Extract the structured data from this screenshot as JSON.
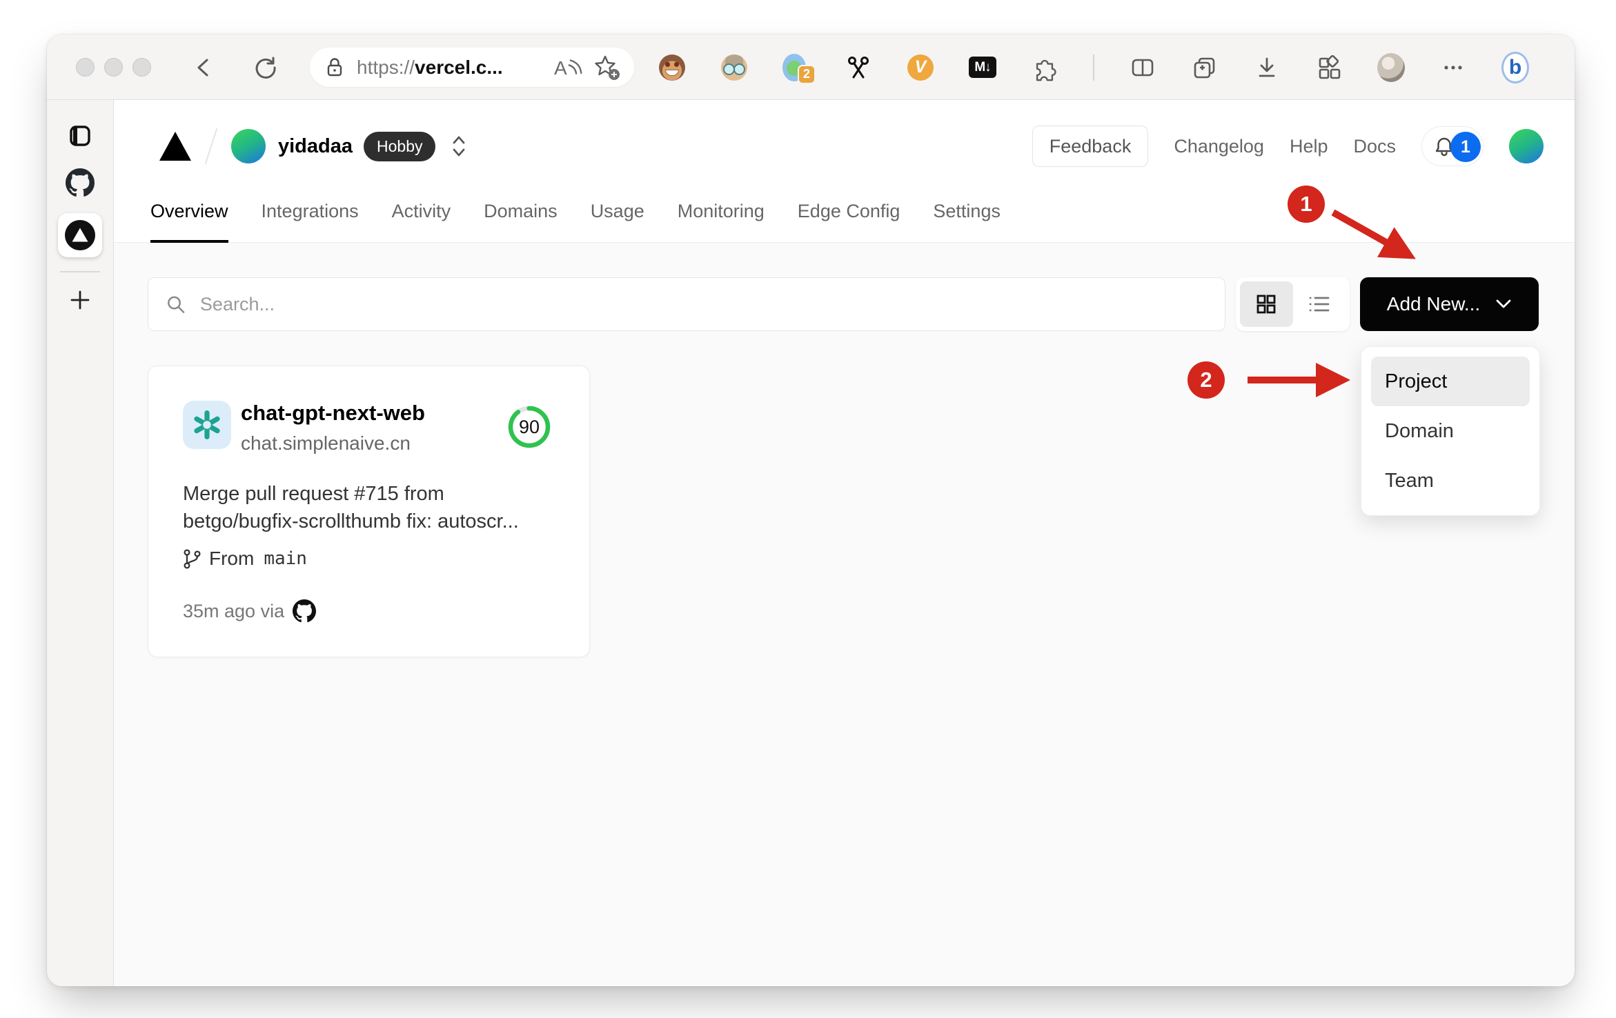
{
  "browser": {
    "url_scheme": "https://",
    "url_host": "vercel.c...",
    "extension_badge": "2",
    "markdown_icon_label": "M↓",
    "v_icon_label": "V",
    "bing_icon_label": "b"
  },
  "header": {
    "team_name": "yidadaa",
    "plan_badge": "Hobby",
    "feedback_label": "Feedback",
    "changelog_label": "Changelog",
    "help_label": "Help",
    "docs_label": "Docs",
    "notification_count": "1"
  },
  "tabs": [
    {
      "label": "Overview",
      "active": true
    },
    {
      "label": "Integrations"
    },
    {
      "label": "Activity"
    },
    {
      "label": "Domains"
    },
    {
      "label": "Usage"
    },
    {
      "label": "Monitoring"
    },
    {
      "label": "Edge Config"
    },
    {
      "label": "Settings"
    }
  ],
  "controls": {
    "search_placeholder": "Search...",
    "add_new_label": "Add New..."
  },
  "add_new_menu": {
    "items": [
      {
        "label": "Project",
        "highlighted": true
      },
      {
        "label": "Domain"
      },
      {
        "label": "Team"
      }
    ]
  },
  "project_card": {
    "name": "chat-gpt-next-web",
    "domain": "chat.simplenaive.cn",
    "score": "90",
    "score_pct": 90,
    "commit_message": "Merge pull request #715 from betgo/bugfix-scrollthumb fix: autoscr...",
    "branch_label": "From",
    "branch_name": "main",
    "footer_text": "35m ago via"
  },
  "annotations": {
    "step_1": "1",
    "step_2": "2"
  },
  "colors": {
    "annotation_red": "#d3261c",
    "score_green": "#2fc24f",
    "badge_blue": "#0b6cf0",
    "add_new_bg": "#050505",
    "hobby_badge_bg": "#2e2e2e"
  }
}
